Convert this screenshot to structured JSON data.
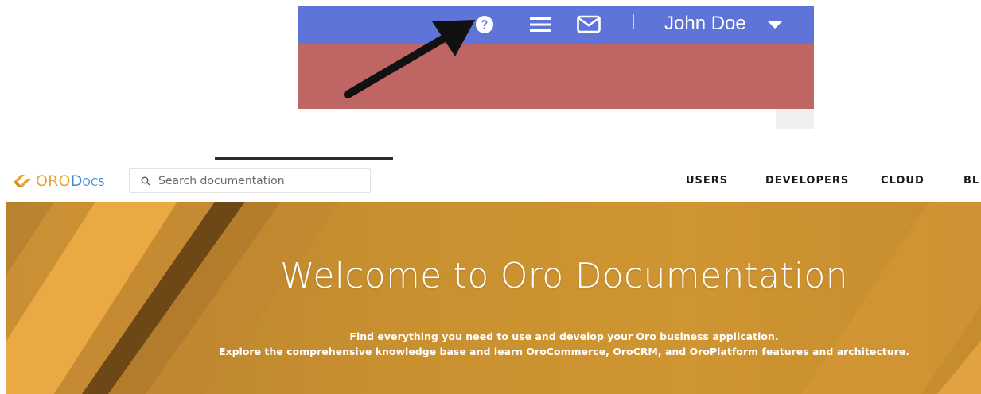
{
  "callout": {
    "user_name": "John Doe",
    "colors": {
      "topbar": "#5f74d8",
      "redbar": "#bf6664",
      "arrow": "#111111"
    },
    "icons": [
      "help-circle-icon",
      "hamburger-menu-icon",
      "mail-icon",
      "caret-down-icon",
      "pointer-arrow"
    ]
  },
  "header": {
    "logo_oro": "ORO",
    "logo_docs": "Docs",
    "search_placeholder": "Search documentation",
    "nav": [
      "USERS",
      "DEVELOPERS",
      "CLOUD",
      "BL"
    ]
  },
  "hero": {
    "title": "Welcome to Oro Documentation",
    "subtitle_line1": "Find everything you need to use and develop your Oro business application.",
    "subtitle_line2": "Explore the comprehensive knowledge base and learn OroCommerce, OroCRM, and OroPlatform features and architecture.",
    "colors": {
      "base": "#c8902f",
      "stripe_light": "#e9a842",
      "stripe_dark": "#6e4716"
    }
  }
}
